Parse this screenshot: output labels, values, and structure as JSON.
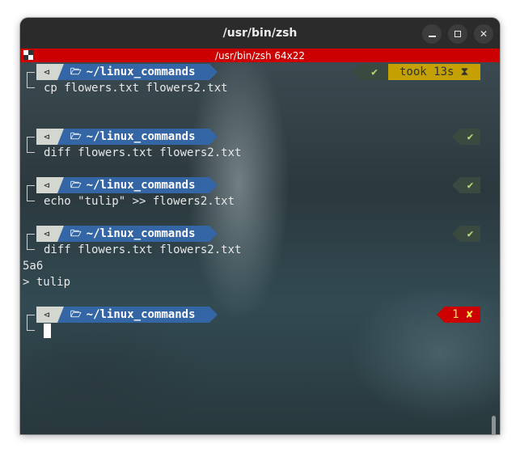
{
  "window": {
    "title": "/usr/bin/zsh",
    "minimize_icon": "minimize-icon",
    "maximize_icon": "maximize-icon",
    "close_icon": "close-icon",
    "close_glyph": "✕"
  },
  "tab": {
    "title": "/usr/bin/zsh 64x22"
  },
  "prompt": {
    "os_glyph": "⊲",
    "folder_glyph": "🗁",
    "dir": "~/linux_commands",
    "ok_glyph": "✔",
    "hourglass_glyph": "⧗",
    "error_glyph": "✘"
  },
  "blocks": [
    {
      "command": "cp flowers.txt flowers2.txt",
      "took": "took 13s"
    },
    {
      "command": "diff flowers.txt flowers2.txt"
    },
    {
      "command": "echo \"tulip\" >> flowers2.txt"
    },
    {
      "command": "diff flowers.txt flowers2.txt",
      "output": [
        "5a6",
        "> tulip"
      ]
    },
    {
      "exit_code": "1"
    }
  ],
  "colors": {
    "tab_red": "#cc0000",
    "dir_blue": "#3465a4",
    "os_gray": "#d3d7cf",
    "took_yellow": "#c4a000",
    "ok_green": "#b6d77a",
    "error_text": "#fce94f"
  }
}
